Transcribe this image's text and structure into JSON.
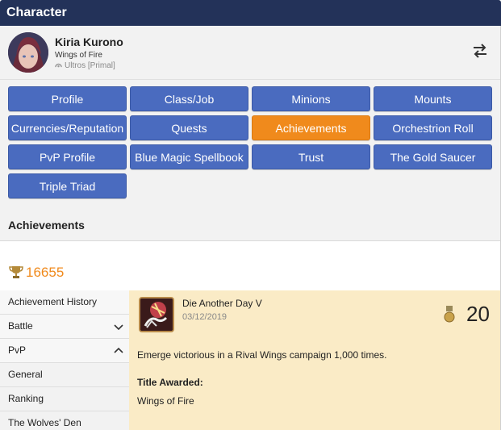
{
  "header": {
    "title": "Character"
  },
  "character": {
    "name": "Kiria Kurono",
    "title": "Wings of Fire",
    "world": "Ultros [Primal]"
  },
  "nav": {
    "items": [
      {
        "label": "Profile"
      },
      {
        "label": "Class/Job"
      },
      {
        "label": "Minions"
      },
      {
        "label": "Mounts"
      },
      {
        "label": "Currencies/Reputation"
      },
      {
        "label": "Quests"
      },
      {
        "label": "Achievements"
      },
      {
        "label": "Orchestrion Roll"
      },
      {
        "label": "PvP Profile"
      },
      {
        "label": "Blue Magic Spellbook"
      },
      {
        "label": "Trust"
      },
      {
        "label": "The Gold Saucer"
      },
      {
        "label": "Triple Triad"
      }
    ],
    "active": "Achievements",
    "colors": {
      "default": "#4a6bbf",
      "active": "#f08a1c"
    }
  },
  "section": {
    "title": "Achievements"
  },
  "points": {
    "value": "16655",
    "icon": "trophy-icon"
  },
  "sidebar": {
    "items": [
      {
        "label": "Achievement History",
        "icon": ""
      },
      {
        "label": "Battle",
        "icon": "chevron-down-icon"
      },
      {
        "label": "PvP",
        "icon": "chevron-up-icon"
      },
      {
        "label": "General",
        "icon": ""
      },
      {
        "label": "Ranking",
        "icon": ""
      },
      {
        "label": "The Wolves' Den",
        "icon": ""
      }
    ]
  },
  "achievement": {
    "name": "Die Another Day V",
    "date": "03/12/2019",
    "points": "20",
    "description": "Emerge victorious in a Rival Wings campaign 1,000 times.",
    "title_label": "Title Awarded:",
    "title_value": "Wings of Fire"
  }
}
